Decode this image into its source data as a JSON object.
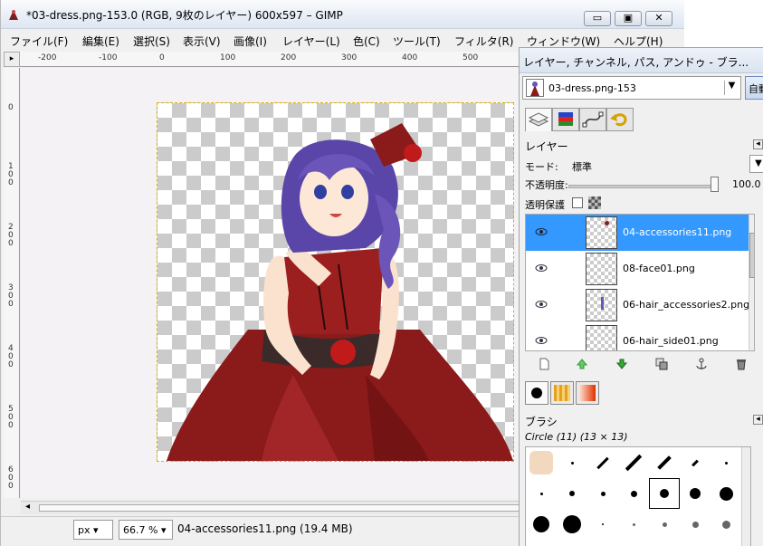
{
  "window": {
    "title": "*03-dress.png-153.0 (RGB, 9枚のレイヤー) 600x597 – GIMP",
    "minimize": "▭",
    "maximize": "▣",
    "close": "✕"
  },
  "menu": [
    "ファイル(F)",
    "編集(E)",
    "選択(S)",
    "表示(V)",
    "画像(I)",
    "レイヤー(L)",
    "色(C)",
    "ツール(T)",
    "フィルタ(R)",
    "ウィンドウ(W)",
    "ヘルプ(H)"
  ],
  "rulers": {
    "top": [
      "-200",
      "-100",
      "0",
      "100",
      "200",
      "300",
      "400",
      "500"
    ],
    "left": [
      "0",
      "100",
      "200",
      "300",
      "400",
      "500",
      "600"
    ]
  },
  "statusbar": {
    "unit": "px",
    "zoom": "66.7 %",
    "message": "04-accessories11.png (19.4 MB)"
  },
  "dock": {
    "title": "レイヤー, チャンネル, パス, アンドゥ - ブラ...",
    "image_name": "03-dress.png-153",
    "auto_button": "自動",
    "layers_heading": "レイヤー",
    "mode_label": "モード:",
    "mode_value": "標準",
    "opacity_label": "不透明度:",
    "opacity_value": "100.0",
    "opacity_fraction": 1.0,
    "lock_label": "透明保護",
    "layers": [
      {
        "name": "04-accessories11.png",
        "selected": true
      },
      {
        "name": "08-face01.png",
        "selected": false
      },
      {
        "name": "06-hair_accessories2.png",
        "selected": false
      },
      {
        "name": "06-hair_side01.png",
        "selected": false
      }
    ],
    "brushes_heading": "ブラシ",
    "brush_name": "Circle (11) (13 × 13)"
  },
  "colors": {
    "selection": "#3399ff",
    "dress": "#8b1a1a",
    "hair": "#6b55b8"
  }
}
